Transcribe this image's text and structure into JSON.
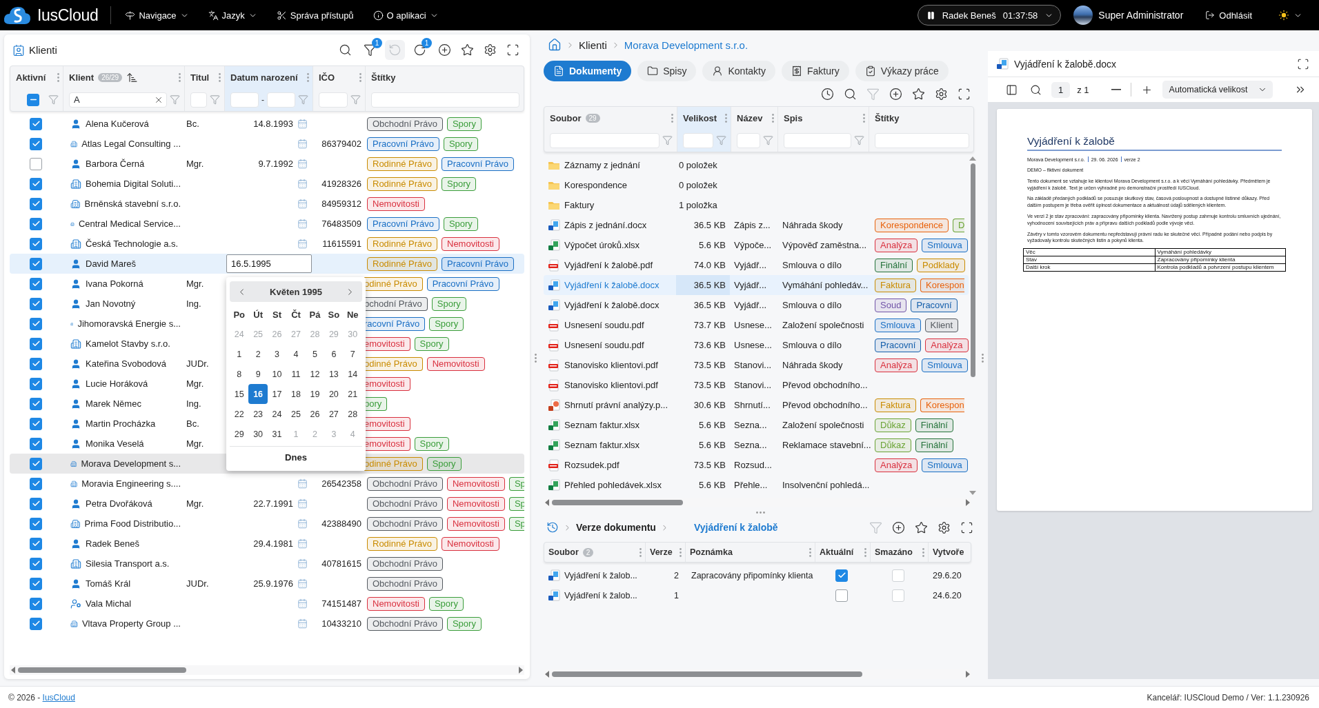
{
  "top_bar": {
    "app_name": "IusCloud",
    "menu": [
      {
        "label": "Navigace",
        "has_menu": true
      },
      {
        "label": "Jazyk",
        "has_menu": true
      },
      {
        "label": "Správa přístupů",
        "has_menu": false
      },
      {
        "label": "O aplikaci",
        "has_menu": true
      }
    ],
    "timer": {
      "user": "Radek Beneš",
      "time": "01:37:58",
      "running": true
    },
    "user": "Super Administrator",
    "logout": "Odhlásit"
  },
  "clients_panel": {
    "title": "Klienti",
    "toolbar": [
      {
        "disabled": false
      },
      {
        "disabled": false,
        "badge": "1"
      },
      {
        "disabled": true
      },
      {
        "disabled": false,
        "badge": "1"
      },
      {
        "disabled": false
      },
      {
        "disabled": false
      },
      {
        "disabled": false
      },
      {
        "disabled": false
      }
    ],
    "columns": [
      {
        "label": "Aktivní",
        "active": false,
        "sorted": false,
        "filter": {
          "kind": "checkbox",
          "some_checked": true
        }
      },
      {
        "label": "Klient",
        "count": "26/29",
        "active": false,
        "sorted": true,
        "filter": {
          "kind": "text",
          "value": "A"
        }
      },
      {
        "label": "Titul",
        "active": false,
        "sorted": false,
        "filter": {
          "kind": "text"
        }
      },
      {
        "label": "Datum narození",
        "active": true,
        "sorted": false,
        "filter": {
          "kind": "range",
          "separator": "-"
        }
      },
      {
        "label": "IČO",
        "active": false,
        "sorted": false,
        "filter": {
          "kind": "text"
        }
      },
      {
        "label": "Štítky",
        "active": false,
        "sorted": false,
        "filter": {
          "kind": "tags"
        }
      }
    ],
    "rows": [
      {
        "kind": "person",
        "active": true,
        "selected": false,
        "name": "Alena Kučerová",
        "title": "Bc.",
        "birth_date": "14.8.1993",
        "tags": [
          {
            "label": "Obchodní Právo",
            "color": "#555a60"
          },
          {
            "label": "Spory",
            "color": "#3a9d3a"
          }
        ]
      },
      {
        "kind": "company",
        "active": true,
        "selected": false,
        "name": "Atlas Legal Consulting ...",
        "ico": "86379402",
        "tags": [
          {
            "label": "Pracovní Právo",
            "color": "#1a6fc4"
          },
          {
            "label": "Spory",
            "color": "#3a9d3a"
          }
        ]
      },
      {
        "kind": "person",
        "active": false,
        "selected": false,
        "name": "Barbora Černá",
        "title": "Mgr.",
        "birth_date": "9.7.1992",
        "tags": [
          {
            "label": "Rodinné Právo",
            "color": "#c98b00"
          },
          {
            "label": "Pracovní Právo",
            "color": "#1a6fc4"
          }
        ]
      },
      {
        "kind": "company",
        "active": true,
        "selected": false,
        "name": "Bohemia Digital Soluti...",
        "ico": "41928326",
        "tags": [
          {
            "label": "Rodinné Právo",
            "color": "#c98b00"
          },
          {
            "label": "Spory",
            "color": "#3a9d3a"
          }
        ]
      },
      {
        "kind": "company",
        "active": true,
        "selected": false,
        "name": "Brněnská stavební s.r.o.",
        "ico": "84959312",
        "tags": [
          {
            "label": "Nemovitosti",
            "color": "#d9303e"
          }
        ]
      },
      {
        "kind": "company",
        "active": true,
        "selected": false,
        "name": "Central Medical Service...",
        "ico": "76483509",
        "tags": [
          {
            "label": "Pracovní Právo",
            "color": "#1a6fc4"
          },
          {
            "label": "Spory",
            "color": "#3a9d3a"
          }
        ]
      },
      {
        "kind": "company",
        "active": true,
        "selected": false,
        "name": "Česká Technologie a.s.",
        "ico": "11615591",
        "tags": [
          {
            "label": "Rodinné Právo",
            "color": "#c98b00"
          },
          {
            "label": "Nemovitosti",
            "color": "#d9303e"
          }
        ]
      },
      {
        "kind": "person",
        "active": true,
        "selected": false,
        "editing": true,
        "name": "David Mareš",
        "birth_date": "16.5.1995",
        "tags": [
          {
            "label": "Rodinné Právo",
            "color": "#c98b00"
          },
          {
            "label": "Pracovní Právo",
            "color": "#1a6fc4"
          }
        ]
      },
      {
        "kind": "person",
        "active": true,
        "selected": false,
        "name": "Ivana Pokorná",
        "title": "Mgr.",
        "tags": [
          {
            "label": "odinné Právo",
            "color": "#c98b00",
            "cut_left": true
          },
          {
            "label": "Pracovní Právo",
            "color": "#1a6fc4"
          }
        ]
      },
      {
        "kind": "person",
        "active": true,
        "selected": false,
        "name": "Jan Novotný",
        "title": "Ing.",
        "tags": [
          {
            "label": "bchodní Právo",
            "color": "#555a60",
            "cut_left": true
          },
          {
            "label": "Spory",
            "color": "#3a9d3a"
          }
        ]
      },
      {
        "kind": "company",
        "active": true,
        "selected": false,
        "name": "Jihomoravská Energie s...",
        "tags": [
          {
            "label": "racovní Právo",
            "color": "#1a6fc4",
            "cut_left": true
          },
          {
            "label": "Spory",
            "color": "#3a9d3a"
          }
        ]
      },
      {
        "kind": "company",
        "active": true,
        "selected": false,
        "name": "Kamelot Stavby s.r.o.",
        "tags": [
          {
            "label": "emovitosti",
            "color": "#d9303e",
            "cut_left": true
          },
          {
            "label": "Spory",
            "color": "#3a9d3a"
          }
        ]
      },
      {
        "kind": "person",
        "active": true,
        "selected": false,
        "name": "Kateřina Svobodová",
        "title": "JUDr.",
        "tags": [
          {
            "label": "odinné Právo",
            "color": "#c98b00",
            "cut_left": true
          },
          {
            "label": "Nemovitosti",
            "color": "#d9303e"
          }
        ]
      },
      {
        "kind": "person",
        "active": true,
        "selected": false,
        "name": "Lucie Horáková",
        "title": "Mgr.",
        "tags": [
          {
            "label": "emovitosti",
            "color": "#d9303e",
            "cut_left": true
          }
        ]
      },
      {
        "kind": "person",
        "active": true,
        "selected": false,
        "name": "Marek Němec",
        "title": "Ing.",
        "tags": [
          {
            "label": "pory",
            "color": "#3a9d3a",
            "cut_left": true
          }
        ]
      },
      {
        "kind": "person",
        "active": true,
        "selected": false,
        "name": "Martin Procházka",
        "title": "Bc.",
        "tags": [
          {
            "label": "emovitosti",
            "color": "#d9303e",
            "cut_left": true
          }
        ]
      },
      {
        "kind": "person",
        "active": true,
        "selected": false,
        "name": "Monika Veselá",
        "title": "Mgr.",
        "tags": [
          {
            "label": "emovitosti",
            "color": "#d9303e",
            "cut_left": true
          },
          {
            "label": "Spory",
            "color": "#3a9d3a"
          }
        ]
      },
      {
        "kind": "company",
        "active": true,
        "selected": true,
        "name": "Morava Development s...",
        "tags": [
          {
            "label": "odinné Právo",
            "color": "#c98b00",
            "cut_left": true
          },
          {
            "label": "Spory",
            "color": "#3a9d3a"
          }
        ]
      },
      {
        "kind": "company",
        "active": true,
        "selected": false,
        "name": "Moravia Engineering s....",
        "ico": "26542358",
        "tags": [
          {
            "label": "Obchodní Právo",
            "color": "#555a60"
          },
          {
            "label": "Nemovitosti",
            "color": "#d9303e"
          },
          {
            "label": "Sp",
            "color": "#3a9d3a",
            "cut_right": true
          }
        ]
      },
      {
        "kind": "person",
        "active": true,
        "selected": false,
        "name": "Petra Dvořáková",
        "title": "Mgr.",
        "birth_date": "22.7.1991",
        "tags": [
          {
            "label": "Obchodní Právo",
            "color": "#555a60"
          },
          {
            "label": "Nemovitosti",
            "color": "#d9303e"
          },
          {
            "label": "Sp",
            "color": "#3a9d3a",
            "cut_right": true
          }
        ]
      },
      {
        "kind": "company",
        "active": true,
        "selected": false,
        "name": "Prima Food Distributio...",
        "ico": "42388490",
        "tags": [
          {
            "label": "Obchodní Právo",
            "color": "#555a60"
          },
          {
            "label": "Nemovitosti",
            "color": "#d9303e"
          },
          {
            "label": "Sp",
            "color": "#3a9d3a",
            "cut_right": true
          }
        ]
      },
      {
        "kind": "person",
        "active": true,
        "selected": false,
        "name": "Radek Beneš",
        "birth_date": "29.4.1981",
        "tags": [
          {
            "label": "Rodinné Právo",
            "color": "#c98b00"
          },
          {
            "label": "Nemovitosti",
            "color": "#d9303e"
          }
        ]
      },
      {
        "kind": "company",
        "active": true,
        "selected": false,
        "name": "Silesia Transport a.s.",
        "ico": "40781615",
        "tags": [
          {
            "label": "Obchodní Právo",
            "color": "#555a60"
          }
        ]
      },
      {
        "kind": "person",
        "active": true,
        "selected": false,
        "name": "Tomáš Král",
        "title": "JUDr.",
        "birth_date": "25.9.1976",
        "tags": [
          {
            "label": "Obchodní Právo",
            "color": "#555a60"
          }
        ]
      },
      {
        "kind": "contact",
        "active": true,
        "selected": false,
        "name": "Vala Michal",
        "ico": "74151487",
        "tags": [
          {
            "label": "Nemovitosti",
            "color": "#d9303e"
          },
          {
            "label": "Spory",
            "color": "#3a9d3a"
          }
        ]
      },
      {
        "kind": "company",
        "active": true,
        "selected": false,
        "name": "Vltava Property Group ...",
        "ico": "10433210",
        "tags": [
          {
            "label": "Obchodní Právo",
            "color": "#555a60"
          },
          {
            "label": "Spory",
            "color": "#3a9d3a"
          }
        ]
      }
    ],
    "date_picker": {
      "month": "Květen 1995",
      "weekdays": [
        "Po",
        "Út",
        "St",
        "Čt",
        "Pá",
        "So",
        "Ne"
      ],
      "today": "Dnes",
      "days": [
        {
          "label": "24",
          "outside": true,
          "selected": false
        },
        {
          "label": "25",
          "outside": true,
          "selected": false
        },
        {
          "label": "26",
          "outside": true,
          "selected": false
        },
        {
          "label": "27",
          "outside": true,
          "selected": false
        },
        {
          "label": "28",
          "outside": true,
          "selected": false
        },
        {
          "label": "29",
          "outside": true,
          "selected": false
        },
        {
          "label": "30",
          "outside": true,
          "selected": false
        },
        {
          "label": "1",
          "outside": false,
          "selected": false
        },
        {
          "label": "2",
          "outside": false,
          "selected": false
        },
        {
          "label": "3",
          "outside": false,
          "selected": false
        },
        {
          "label": "4",
          "outside": false,
          "selected": false
        },
        {
          "label": "5",
          "outside": false,
          "selected": false
        },
        {
          "label": "6",
          "outside": false,
          "selected": false
        },
        {
          "label": "7",
          "outside": false,
          "selected": false
        },
        {
          "label": "8",
          "outside": false,
          "selected": false
        },
        {
          "label": "9",
          "outside": false,
          "selected": false
        },
        {
          "label": "10",
          "outside": false,
          "selected": false
        },
        {
          "label": "11",
          "outside": false,
          "selected": false
        },
        {
          "label": "12",
          "outside": false,
          "selected": false
        },
        {
          "label": "13",
          "outside": false,
          "selected": false
        },
        {
          "label": "14",
          "outside": false,
          "selected": false
        },
        {
          "label": "15",
          "outside": false,
          "selected": false
        },
        {
          "label": "16",
          "outside": false,
          "selected": true
        },
        {
          "label": "17",
          "outside": false,
          "selected": false
        },
        {
          "label": "18",
          "outside": false,
          "selected": false
        },
        {
          "label": "19",
          "outside": false,
          "selected": false
        },
        {
          "label": "20",
          "outside": false,
          "selected": false
        },
        {
          "label": "21",
          "outside": false,
          "selected": false
        },
        {
          "label": "22",
          "outside": false,
          "selected": false
        },
        {
          "label": "23",
          "outside": false,
          "selected": false
        },
        {
          "label": "24",
          "outside": false,
          "selected": false
        },
        {
          "label": "25",
          "outside": false,
          "selected": false
        },
        {
          "label": "26",
          "outside": false,
          "selected": false
        },
        {
          "label": "27",
          "outside": false,
          "selected": false
        },
        {
          "label": "28",
          "outside": false,
          "selected": false
        },
        {
          "label": "29",
          "outside": false,
          "selected": false
        },
        {
          "label": "30",
          "outside": false,
          "selected": false
        },
        {
          "label": "31",
          "outside": false,
          "selected": false
        },
        {
          "label": "1",
          "outside": true,
          "selected": false
        },
        {
          "label": "2",
          "outside": true,
          "selected": false
        },
        {
          "label": "3",
          "outside": true,
          "selected": false
        },
        {
          "label": "4",
          "outside": true,
          "selected": false
        }
      ]
    }
  },
  "client_detail": {
    "breadcrumb": [
      "Klienti",
      "Morava Development s.r.o."
    ],
    "tabs": [
      {
        "label": "Dokumenty",
        "selected": true
      },
      {
        "label": "Spisy",
        "selected": false
      },
      {
        "label": "Kontakty",
        "selected": false
      },
      {
        "label": "Faktury",
        "selected": false
      },
      {
        "label": "Výkazy práce",
        "selected": false
      }
    ],
    "toolbar": [
      {
        "disabled": false
      },
      {
        "disabled": false
      },
      {
        "disabled": true
      },
      {
        "disabled": false
      },
      {
        "disabled": false
      },
      {
        "disabled": false
      },
      {
        "disabled": false
      }
    ],
    "documents": {
      "columns": [
        {
          "label": "Soubor",
          "count": "29",
          "active": false
        },
        {
          "label": "Velikost",
          "active": true
        },
        {
          "label": "Název",
          "active": false
        },
        {
          "label": "Spis",
          "active": false
        },
        {
          "label": "Štítky",
          "active": false
        }
      ],
      "rows": [
        {
          "kind": "folder",
          "selected": false,
          "file": "Záznamy z jednání",
          "size": "0 položek"
        },
        {
          "kind": "folder",
          "selected": false,
          "file": "Korespondence",
          "size": "0 položek"
        },
        {
          "kind": "folder",
          "selected": false,
          "file": "Faktury",
          "size": "1 položka"
        },
        {
          "kind": "word",
          "selected": false,
          "file": "Zápis z jednání.docx",
          "size": "36.5 KB",
          "name": "Zápis z...",
          "case": "Náhrada škody",
          "tags": [
            {
              "label": "Korespondence",
              "color": "#e8620c"
            },
            {
              "label": "D",
              "color": "#6aa334",
              "cut_right": true
            }
          ]
        },
        {
          "kind": "excel",
          "selected": false,
          "file": "Výpočet úroků.xlsx",
          "size": "5.6 KB",
          "name": "Výpoče...",
          "case": "Výpověď zaměstna...",
          "tags": [
            {
              "label": "Analýza",
              "color": "#d9303e"
            },
            {
              "label": "Smlouva",
              "color": "#1a6fc4"
            }
          ]
        },
        {
          "kind": "pdf",
          "selected": false,
          "file": "Vyjádření k žalobě.pdf",
          "size": "74.0 KB",
          "name": "Vyjádř...",
          "case": "Smlouva o dílo",
          "tags": [
            {
              "label": "Finální",
              "color": "#24723a"
            },
            {
              "label": "Podklady",
              "color": "#c98b00"
            }
          ]
        },
        {
          "kind": "word",
          "selected": true,
          "file": "Vyjádření k žalobě.docx",
          "size": "36.5 KB",
          "name": "Vyjádř...",
          "case": "Vymáhání pohledáv...",
          "tags": [
            {
              "label": "Faktura",
              "color": "#c98b00"
            },
            {
              "label": "Korespon",
              "color": "#e8620c",
              "cut_right": true
            }
          ]
        },
        {
          "kind": "word",
          "selected": false,
          "file": "Vyjádření k žalobě.docx",
          "size": "36.5 KB",
          "name": "Vyjádř...",
          "case": "Smlouva o dílo",
          "tags": [
            {
              "label": "Soud",
              "color": "#7154a8"
            },
            {
              "label": "Pracovní",
              "color": "#155fab"
            }
          ]
        },
        {
          "kind": "pdf",
          "selected": false,
          "file": "Usnesení soudu.pdf",
          "size": "73.7 KB",
          "name": "Usnese...",
          "case": "Založení společnosti",
          "tags": [
            {
              "label": "Smlouva",
              "color": "#1a6fc4"
            },
            {
              "label": "Klient",
              "color": "#555a60"
            }
          ]
        },
        {
          "kind": "pdf",
          "selected": false,
          "file": "Usnesení soudu.pdf",
          "size": "73.6 KB",
          "name": "Usnese...",
          "case": "Smlouva o dílo",
          "tags": [
            {
              "label": "Pracovní",
              "color": "#155fab"
            },
            {
              "label": "Analýza",
              "color": "#d9303e"
            }
          ]
        },
        {
          "kind": "pdf",
          "selected": false,
          "file": "Stanovisko klientovi.pdf",
          "size": "73.5 KB",
          "name": "Stanovi...",
          "case": "Náhrada škody",
          "tags": [
            {
              "label": "Analýza",
              "color": "#d9303e"
            },
            {
              "label": "Smlouva",
              "color": "#1a6fc4"
            }
          ]
        },
        {
          "kind": "pdf",
          "selected": false,
          "file": "Stanovisko klientovi.pdf",
          "size": "73.5 KB",
          "name": "Stanovi...",
          "case": "Převod obchodního..."
        },
        {
          "kind": "powerpoint",
          "selected": false,
          "file": "Shrnutí právní analýzy.p...",
          "size": "30.6 KB",
          "name": "Shrnutí...",
          "case": "Převod obchodního...",
          "tags": [
            {
              "label": "Faktura",
              "color": "#c98b00"
            },
            {
              "label": "Korespon",
              "color": "#e8620c",
              "cut_right": true
            }
          ]
        },
        {
          "kind": "excel",
          "selected": false,
          "file": "Seznam faktur.xlsx",
          "size": "5.6 KB",
          "name": "Sezna...",
          "case": "Založení společnosti",
          "tags": [
            {
              "label": "Důkaz",
              "color": "#6aa334"
            },
            {
              "label": "Finální",
              "color": "#24723a"
            }
          ]
        },
        {
          "kind": "excel",
          "selected": false,
          "file": "Seznam faktur.xlsx",
          "size": "5.6 KB",
          "name": "Sezna...",
          "case": "Reklamace stavební...",
          "tags": [
            {
              "label": "Důkaz",
              "color": "#6aa334"
            },
            {
              "label": "Finální",
              "color": "#24723a"
            }
          ]
        },
        {
          "kind": "pdf",
          "selected": false,
          "file": "Rozsudek.pdf",
          "size": "73.5 KB",
          "name": "Rozsud...",
          "tags": [
            {
              "label": "Analýza",
              "color": "#d9303e"
            },
            {
              "label": "Smlouva",
              "color": "#1a6fc4"
            }
          ]
        },
        {
          "kind": "excel",
          "selected": false,
          "file": "Přehled pohledávek.xlsx",
          "size": "5.6 KB",
          "name": "Přehle...",
          "case": "Insolvenční pohledá..."
        }
      ]
    },
    "versions": {
      "title": "Verze dokumentu",
      "document": "Vyjádření k žalobě",
      "toolbar": [
        {
          "disabled": true
        },
        {
          "disabled": false
        },
        {
          "disabled": false
        },
        {
          "disabled": false
        },
        {
          "disabled": false
        }
      ],
      "columns": [
        {
          "label": "Soubor",
          "count": "2"
        },
        {
          "label": "Verze"
        },
        {
          "label": "Poznámka"
        },
        {
          "label": "Aktuální"
        },
        {
          "label": "Smazáno"
        },
        {
          "label": "Vytvoře"
        }
      ],
      "rows": [
        {
          "file": "Vyjádření k žalob...",
          "version": "2",
          "note": "Zapracovány připomínky klienta",
          "current": true,
          "deleted": false,
          "created": "29.6.20"
        },
        {
          "file": "Vyjádření k žalob...",
          "version": "1",
          "current": false,
          "deleted": false,
          "created": "24.6.20"
        }
      ]
    }
  },
  "preview": {
    "title": "Vyjádření k žalobě.docx",
    "page": "1",
    "page_count": "z 1",
    "zoom": "Automatická velikost",
    "document": {
      "heading": "Vyjádření k žalobě",
      "meta": [
        "Morava Development s.r.o.",
        "29. 06. 2026",
        "verze 2"
      ],
      "paragraphs": [
        "DEMO – fiktivní dokument",
        "Tento dokument se vztahuje ke klientovi Morava Development s.r.o. a k věci Vymáhání pohledávky. Předmětem je vyjádření k žalobě. Text je určen výhradně pro demonstrační prostředí IUSCloud.",
        "Na základě předaných podkladů se posuzuje skutkový stav, časová posloupnost a dostupné listinné důkazy. Před dalším postupem je třeba ověřit úplnost dokumentace a aktuálnost údajů sdělených klientem.",
        "Ve verzi 2 je stav zpracování: zapracovány připomínky klienta. Navržený postup zahrnuje kontrolu smluvních ujednání, vyhodnocení souvisejících práv a přípravu dalších podkladů podle vývoje věci.",
        "Závěry v tomto vzorovém dokumentu nepředstavují právní radu ke skutečné věci. Případné podání nebo podpis by vyžadovaly kontrolu skutečných listin a pokynů klienta."
      ],
      "table": [
        [
          "Věc",
          "Vymáhání pohledávky"
        ],
        [
          "Stav",
          "Zapracovány připomínky klienta"
        ],
        [
          "Další krok",
          "Kontrola podkladů a potvrzení postupu klientem"
        ]
      ]
    }
  },
  "footer": {
    "copyright": "© 2026 - ",
    "link": "IusCloud",
    "info": "Kancelář: IUSCloud Demo / Ver: 1.1.230926"
  }
}
